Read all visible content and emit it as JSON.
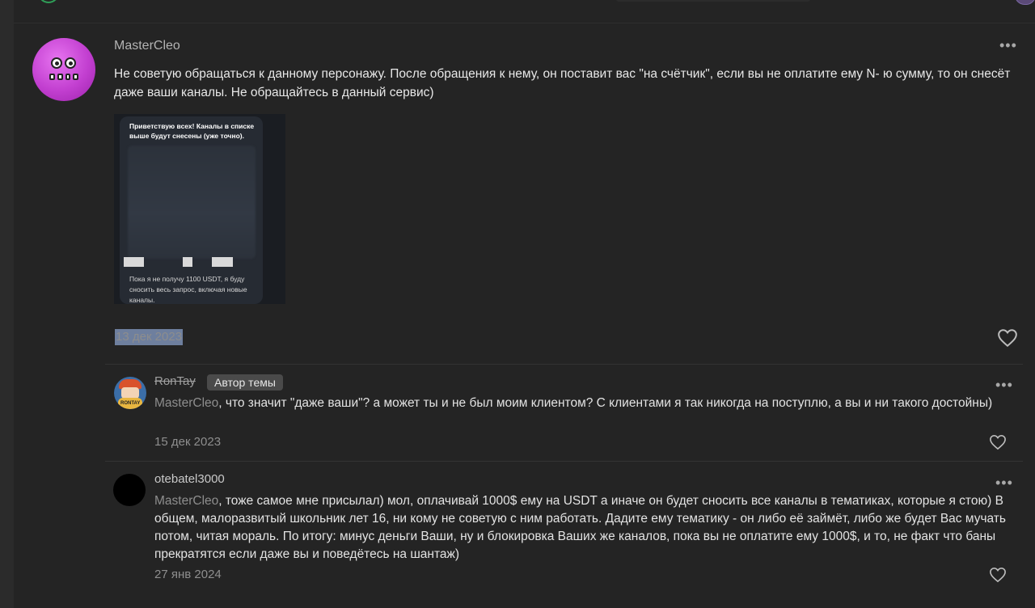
{
  "main_post": {
    "author": "MasterCleo",
    "text": "Не советую обращаться к данному персонажу. После обращения к нему, он поставит вас \"на счётчик\", если вы не оплатите ему N- ю сумму, то он снесёт даже ваши каналы. Не обращайтесь в данный сервис)",
    "date": "13 дек 2023",
    "attachment": {
      "top_text": "Приветствую всех! Каналы в списке выше будут снесены (уже точно).",
      "bottom_text": "Пока я не получу 1100 USDT, я буду сносить весь запрос, включая новые каналы."
    }
  },
  "replies": [
    {
      "author": "RonTay",
      "badge": "Автор темы",
      "mention": "MasterCleo",
      "text": ", что значит \"даже ваши\"? а может ты и не был моим клиентом? С клиентами я так никогда на поступлю, а вы и ни такого достойны)",
      "date": "15 дек 2023"
    },
    {
      "author": "otebatel3000",
      "mention": "MasterCleo",
      "text": ", тоже самое мне присылал) мол, оплачивай 1000$ ему на USDT а иначе он будет сносить все каналы в тематиках, которые я стою) В общем, малоразвитый школьник лет 16, ни кому не советую с ним работать. Дадите ему тематику - он либо её займёт, либо же будет Вас мучать потом, читая мораль. По итогу: минус деньги Ваши, ну и блокировка Ваших же каналов, пока вы не оплатите ему 1000$, и то, не факт что баны прекратятся если даже вы и поведётесь на шантаж)",
      "date": "27 янв 2024"
    }
  ],
  "icons": {
    "more": "more-options-icon",
    "like": "heart-icon"
  },
  "colors": {
    "background": "#242424",
    "text": "#e8e8e8",
    "muted": "#8e8e8e",
    "badge": "#4a4a4a",
    "avatar_purple": "#c23fd0",
    "selection": "#6e7f9e"
  }
}
